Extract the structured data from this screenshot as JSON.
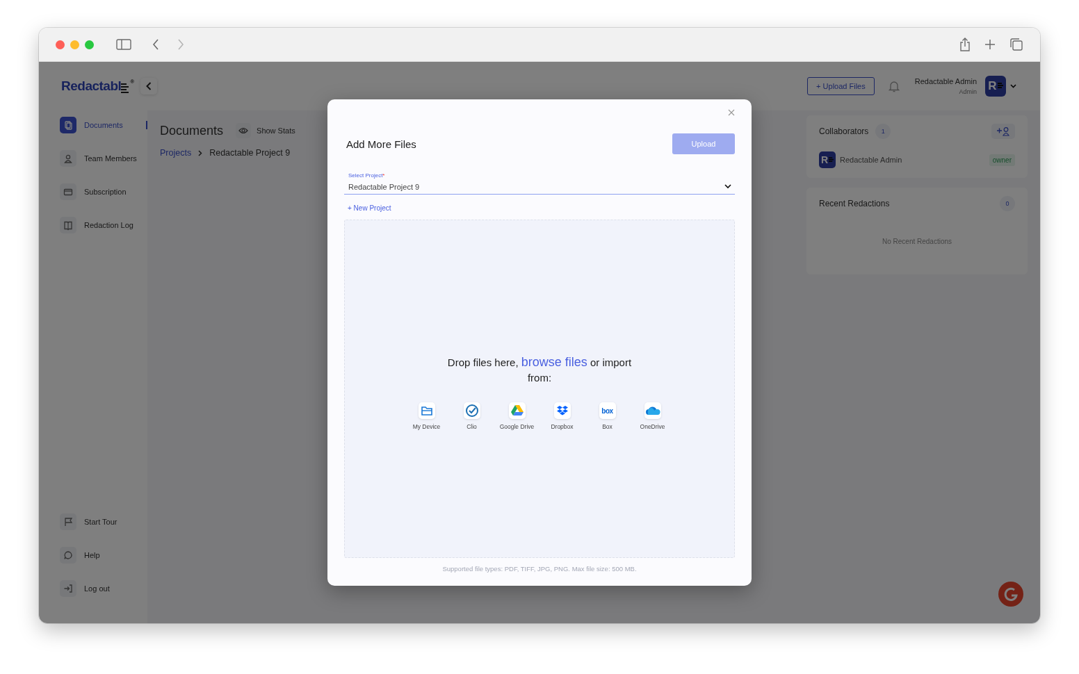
{
  "app": {
    "logo": {
      "text": "Redactabl",
      "mark": "®"
    },
    "sidebar": {
      "items": [
        {
          "kind": "documents",
          "label": "Documents",
          "selected": true
        },
        {
          "kind": "team",
          "label": "Team Members",
          "selected": false
        },
        {
          "kind": "subscription",
          "label": "Subscription",
          "selected": false
        },
        {
          "kind": "log",
          "label": "Redaction Log",
          "selected": false
        }
      ],
      "bottom_items": [
        {
          "kind": "tour",
          "label": "Start Tour"
        },
        {
          "kind": "help",
          "label": "Help"
        },
        {
          "kind": "logout",
          "label": "Log out"
        }
      ]
    },
    "header": {
      "upload_button": "+ Upload Files",
      "user_name": "Redactable Admin",
      "user_role": "Admin",
      "avatar_letter": "R"
    },
    "page": {
      "title": "Documents",
      "stats_button": "Show Stats",
      "breadcrumb": [
        {
          "label": "Projects",
          "link": true
        },
        {
          "label": "Redactable Project 9",
          "link": false
        }
      ]
    },
    "collaborators": {
      "title": "Collaborators",
      "count": "1",
      "members": [
        {
          "avatar_letter": "R",
          "name": "Redactable Admin",
          "role": "owner"
        }
      ]
    },
    "recent_redactions": {
      "title": "Recent Redactions",
      "count": "0",
      "empty": "No Recent Redactions"
    }
  },
  "modal": {
    "title": "Add More Files",
    "upload_button": {
      "label": "Upload",
      "disabled": true
    },
    "select": {
      "label": "Select Project",
      "required_mark": "*",
      "value": "Redactable Project 9"
    },
    "new_project_link": "+ New Project",
    "drop_text": "Drop files here, **browse files** or import from:",
    "sources": [
      {
        "kind": "device",
        "label": "My Device"
      },
      {
        "kind": "clio",
        "label": "Clio"
      },
      {
        "kind": "gdrive",
        "label": "Google Drive"
      },
      {
        "kind": "dropbox",
        "label": "Dropbox"
      },
      {
        "kind": "box",
        "label": "Box",
        "icon_text": "box"
      },
      {
        "kind": "onedrive",
        "label": "OneDrive"
      }
    ],
    "footnote": "Supported file types: PDF, TIFF, JPG, PNG. Max file size: 500 MB."
  }
}
